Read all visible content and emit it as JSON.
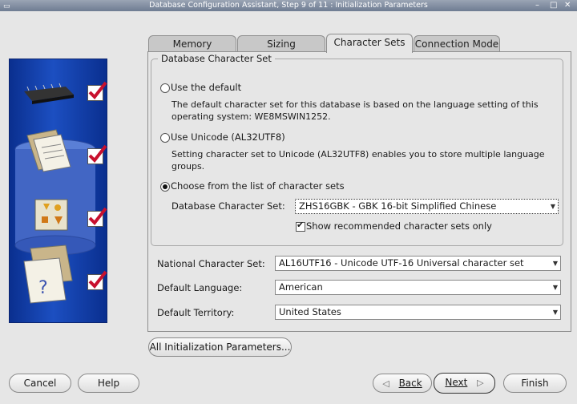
{
  "window": {
    "title": "Database Configuration Assistant, Step 9 of 11 : Initialization Parameters",
    "controls": [
      "–",
      "□",
      "✕"
    ]
  },
  "tabs": [
    "Memory",
    "Sizing",
    "Character Sets",
    "Connection Mode"
  ],
  "active_tab": "Character Sets",
  "db_charset_group": {
    "title": "Database Character Set",
    "use_default_label": "Use the default",
    "use_default_desc_1": "The default character set for this database is based on the language setting of this",
    "use_default_desc_2": "operating system: WE8MSWIN1252.",
    "use_unicode_label": "Use Unicode (AL32UTF8)",
    "use_unicode_desc_1": "Setting character set to Unicode (AL32UTF8) enables you to store multiple language",
    "use_unicode_desc_2": "groups.",
    "choose_label": "Choose from the list of character sets",
    "selected_option": "choose",
    "db_charset_label": "Database Character Set:",
    "db_charset_value": "ZHS16GBK - GBK 16-bit Simplified Chinese",
    "show_recommended_label": "Show recommended character sets only",
    "show_recommended_checked": true
  },
  "national_charset": {
    "label": "National Character Set:",
    "value": "AL16UTF16 - Unicode UTF-16 Universal character set"
  },
  "default_language": {
    "label": "Default Language:",
    "value": "American"
  },
  "default_territory": {
    "label": "Default Territory:",
    "value": "United States"
  },
  "all_params_button": "All Initialization Parameters...",
  "footer": {
    "cancel": "Cancel",
    "help": "Help",
    "back": "Back",
    "next": "Next",
    "finish": "Finish"
  },
  "colors": {
    "art_panel": "#1c4fc1",
    "check_mark": "#c8102e",
    "background": "#e6e6e6"
  }
}
